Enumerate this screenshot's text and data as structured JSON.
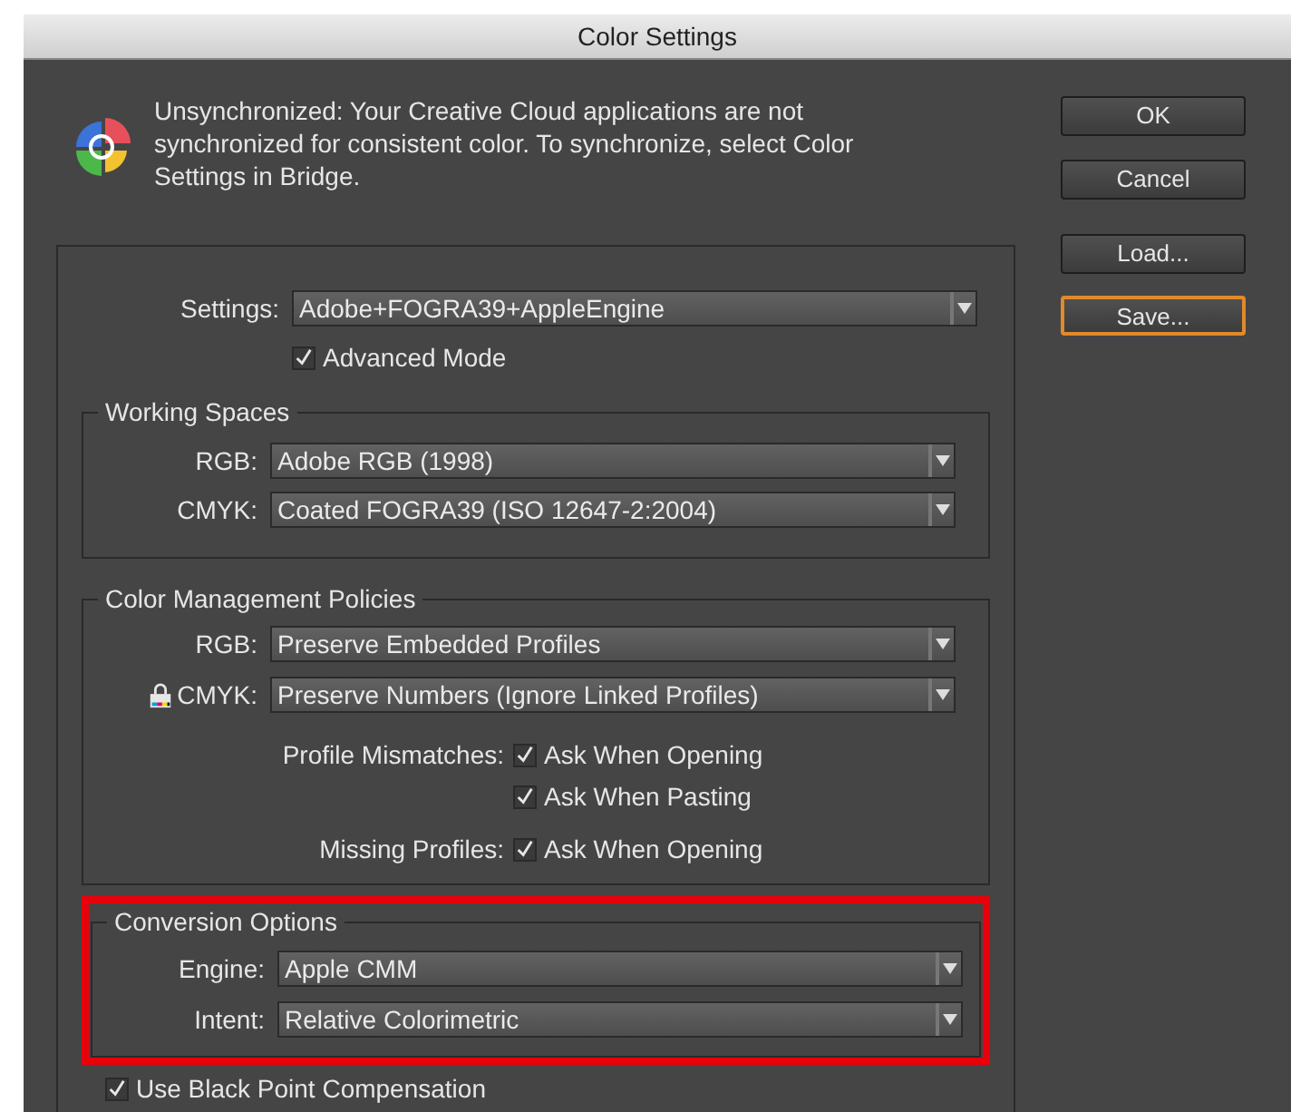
{
  "window": {
    "title": "Color Settings"
  },
  "sync_notice": {
    "text": "Unsynchronized: Your Creative Cloud applications are not synchronized for consistent color. To synchronize, select Color Settings in Bridge."
  },
  "buttons": [
    {
      "label": "OK",
      "focused": false
    },
    {
      "label": "Cancel",
      "focused": false
    },
    {
      "label": "Load...",
      "focused": false
    },
    {
      "label": "Save...",
      "focused": true
    }
  ],
  "settings": {
    "label": "Settings:",
    "value": "Adobe+FOGRA39+AppleEngine"
  },
  "advanced_mode": {
    "label": "Advanced Mode",
    "checked": true
  },
  "working_spaces": {
    "title": "Working Spaces",
    "rows": [
      {
        "label": "RGB:",
        "value": "Adobe RGB (1998)",
        "locked": false
      },
      {
        "label": "CMYK:",
        "value": "Coated FOGRA39 (ISO 12647-2:2004)",
        "locked": false
      }
    ]
  },
  "color_management_policies": {
    "title": "Color Management Policies",
    "rows": [
      {
        "label": "RGB:",
        "value": "Preserve Embedded Profiles",
        "locked": false
      },
      {
        "label": "CMYK:",
        "value": "Preserve Numbers (Ignore Linked Profiles)",
        "locked": true
      }
    ],
    "checks": [
      {
        "label": "Profile Mismatches:",
        "options": [
          {
            "label": "Ask When Opening",
            "checked": true
          },
          {
            "label": "Ask When Pasting",
            "checked": true
          }
        ]
      },
      {
        "label": "Missing Profiles:",
        "options": [
          {
            "label": "Ask When Opening",
            "checked": true
          }
        ]
      }
    ]
  },
  "conversion_options": {
    "title": "Conversion Options",
    "highlighted": true,
    "rows": [
      {
        "label": "Engine:",
        "value": "Apple CMM",
        "locked": false
      },
      {
        "label": "Intent:",
        "value": "Relative Colorimetric",
        "locked": false
      }
    ]
  },
  "black_point_compensation": {
    "label": "Use Black Point Compensation",
    "checked": true
  }
}
